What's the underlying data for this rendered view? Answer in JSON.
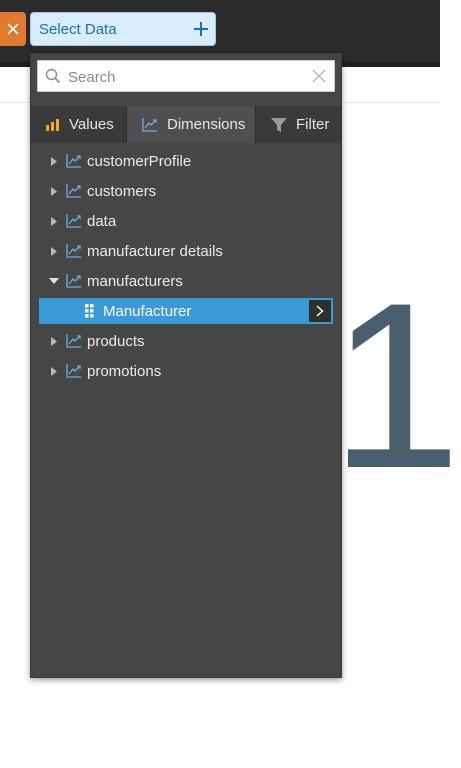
{
  "toolbar": {
    "select_data_label": "Select Data"
  },
  "canvas": {
    "big_value": "1"
  },
  "panel": {
    "search": {
      "placeholder": "Search",
      "value": ""
    },
    "tabs": [
      {
        "label": "Values",
        "icon": "bar-chart-icon"
      },
      {
        "label": "Dimensions",
        "icon": "dimension-icon",
        "active": true
      },
      {
        "label": "Filter",
        "icon": "funnel-icon"
      }
    ],
    "tree": [
      {
        "label": "customerProfile",
        "expanded": false
      },
      {
        "label": "customers",
        "expanded": false
      },
      {
        "label": "data",
        "expanded": false
      },
      {
        "label": "manufacturer details",
        "expanded": false
      },
      {
        "label": "manufacturers",
        "expanded": true,
        "children": [
          {
            "label": "Manufacturer",
            "selected": true
          }
        ]
      },
      {
        "label": "products",
        "expanded": false
      },
      {
        "label": "promotions",
        "expanded": false
      }
    ]
  },
  "colors": {
    "accent": "#3a9ad9",
    "close": "#e07a2f",
    "panel_bg": "#464646",
    "values_icon": "#f5a623"
  }
}
